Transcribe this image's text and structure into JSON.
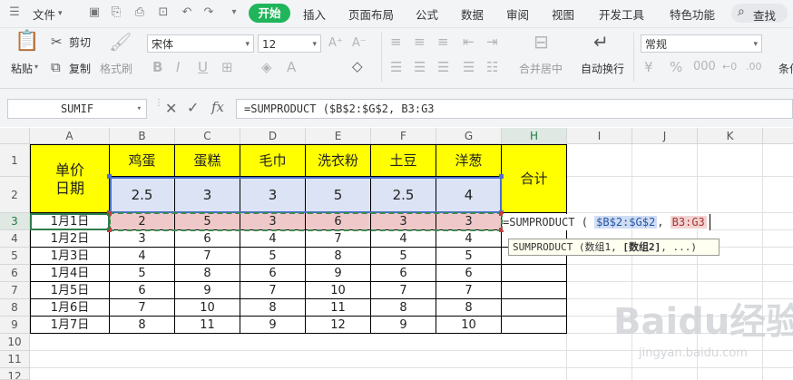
{
  "menu": {
    "file": "文件",
    "tabs": [
      "开始",
      "插入",
      "页面布局",
      "公式",
      "数据",
      "审阅",
      "视图",
      "开发工具",
      "特色功能"
    ],
    "search": "查找"
  },
  "ribbon": {
    "paste": "粘贴",
    "cut": "剪切",
    "copy": "复制",
    "format_painter": "格式刷",
    "font_name": "宋体",
    "font_size": "12",
    "merge_center": "合并居中",
    "wrap_text": "自动换行",
    "number_format": "常规",
    "cond_label": "条件"
  },
  "formula_bar": {
    "name_box": "SUMIF",
    "formula": "=SUMPRODUCT ($B$2:$G$2, B3:G3"
  },
  "columns": [
    "A",
    "B",
    "C",
    "D",
    "E",
    "F",
    "G",
    "H",
    "I",
    "J",
    "K"
  ],
  "rows": [
    "1",
    "2",
    "3",
    "4",
    "5",
    "6",
    "7",
    "8",
    "9",
    "10",
    "11",
    "12"
  ],
  "table": {
    "a1": "单价\n日期",
    "headers": [
      "鸡蛋",
      "蛋糕",
      "毛巾",
      "洗衣粉",
      "土豆",
      "洋葱"
    ],
    "prices": [
      "2.5",
      "3",
      "3",
      "5",
      "2.5",
      "4"
    ],
    "h_header": "合计",
    "dates": [
      "1月1日",
      "1月2日",
      "1月3日",
      "1月4日",
      "1月5日",
      "1月6日",
      "1月7日"
    ],
    "data": [
      [
        "2",
        "5",
        "3",
        "6",
        "3",
        "3"
      ],
      [
        "3",
        "6",
        "4",
        "7",
        "4",
        "4"
      ],
      [
        "4",
        "7",
        "5",
        "8",
        "5",
        "5"
      ],
      [
        "5",
        "8",
        "6",
        "9",
        "6",
        "6"
      ],
      [
        "6",
        "9",
        "7",
        "10",
        "7",
        "7"
      ],
      [
        "7",
        "10",
        "8",
        "11",
        "8",
        "8"
      ],
      [
        "8",
        "11",
        "9",
        "12",
        "9",
        "10"
      ]
    ]
  },
  "edit_cell": {
    "prefix": "=SUMPRODUCT (",
    "ref1": "$B$2:$G$2",
    "sep": ",",
    "ref2": "B3:G3"
  },
  "tooltip": {
    "text": "SUMPRODUCT (数组1, ",
    "bold": "[数组2]",
    "tail": ", ...)"
  },
  "watermark": {
    "logo": "Baidu经验",
    "url": "jingyan.baidu.com"
  },
  "colors": {
    "accent_green": "#20b55a",
    "header_yellow": "#ffff00",
    "row2_blue": "#dbe3f4",
    "row3_pink": "#efc9c9"
  }
}
